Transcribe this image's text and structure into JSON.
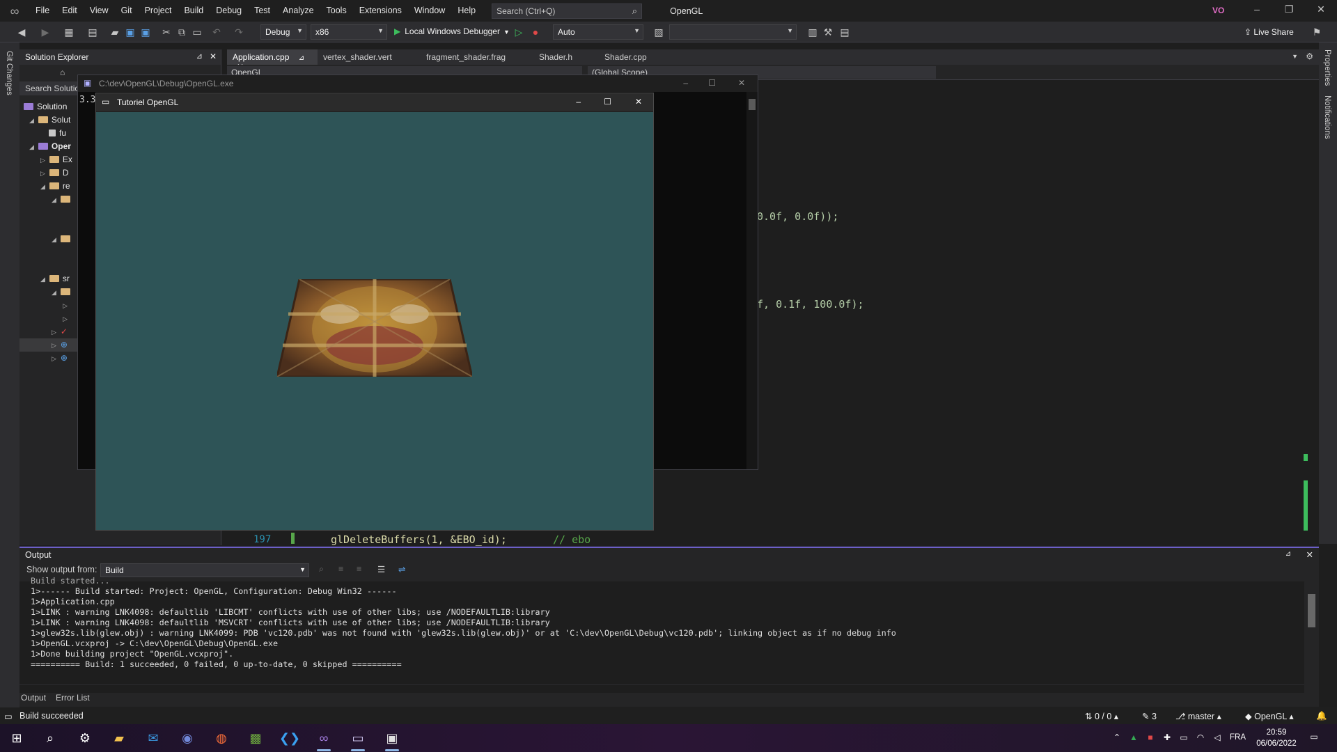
{
  "menu": {
    "items": [
      "File",
      "Edit",
      "View",
      "Git",
      "Project",
      "Build",
      "Debug",
      "Test",
      "Analyze",
      "Tools",
      "Extensions",
      "Window",
      "Help"
    ],
    "search_placeholder": "Search (Ctrl+Q)",
    "app_title": "OpenGL",
    "user_initials": "VO"
  },
  "toolbar": {
    "configuration": "Debug",
    "platform": "x86",
    "debugger": "Local Windows Debugger",
    "mode": "Auto",
    "live_share": "Live Share"
  },
  "side_labels": {
    "left": "Git Changes",
    "right_top": "Properties",
    "right_bottom": "Notifications"
  },
  "solution_explorer": {
    "title": "Solution Explorer",
    "search_placeholder": "Search Solutio",
    "rows": [
      {
        "label": "Solution"
      },
      {
        "label": "Solut"
      },
      {
        "label": "fu"
      },
      {
        "label": "Oper"
      },
      {
        "label": "Ex"
      },
      {
        "label": "D"
      },
      {
        "label": "re"
      },
      {
        "label": "sr"
      }
    ]
  },
  "editor": {
    "tabs": [
      "Application.cpp",
      "vertex_shader.vert",
      "fragment_shader.frag",
      "Shader.h",
      "Shader.cpp"
    ],
    "active_tab": "Application.cpp",
    "nav_project": "OpenGL",
    "nav_scope": "(Global Scope)",
    "code_line_1": "0.0f, 0.0f));",
    "code_line_2": "f, 0.1f, 100.0f);",
    "line_number": "197",
    "last_line_code": "glDeleteBuffers(1, &EBO_id);",
    "last_line_comment": "// ebo"
  },
  "console_window": {
    "title": "C:\\dev\\OpenGL\\Debug\\OpenGL.exe",
    "text": "3.3"
  },
  "gl_window": {
    "title": "Tutoriel OpenGL",
    "clear_color": "#2e5457"
  },
  "output": {
    "title": "Output",
    "show_from_label": "Show output from:",
    "source": "Build",
    "lines": [
      "Build started...",
      "1>------ Build started: Project: OpenGL, Configuration: Debug Win32 ------",
      "1>Application.cpp",
      "1>LINK : warning LNK4098: defaultlib 'LIBCMT' conflicts with use of other libs; use /NODEFAULTLIB:library",
      "1>LINK : warning LNK4098: defaultlib 'MSVCRT' conflicts with use of other libs; use /NODEFAULTLIB:library",
      "1>glew32s.lib(glew.obj) : warning LNK4099: PDB 'vc120.pdb' was not found with 'glew32s.lib(glew.obj)' or at 'C:\\dev\\OpenGL\\Debug\\vc120.pdb'; linking object as if no debug info",
      "1>OpenGL.vcxproj -> C:\\dev\\OpenGL\\Debug\\OpenGL.exe",
      "1>Done building project \"OpenGL.vcxproj\".",
      "========== Build: 1 succeeded, 0 failed, 0 up-to-date, 0 skipped =========="
    ],
    "bottom_tabs": [
      "Output",
      "Error List"
    ]
  },
  "status_bar": {
    "message": "Build succeeded",
    "sync": "0 / 0",
    "changes": "3",
    "branch": "master",
    "repo": "OpenGL"
  },
  "taskbar": {
    "language": "FRA",
    "time": "20:59",
    "date": "06/06/2022"
  }
}
